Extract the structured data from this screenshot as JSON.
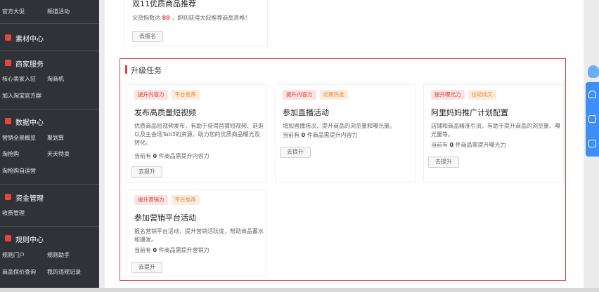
{
  "sidebar": {
    "row1": [
      "官方大促",
      "频道活动"
    ],
    "section_material": "素材中心",
    "section_merchant": "商家服务",
    "merchant_links": [
      [
        "核心卖家入驻",
        "淘商机"
      ],
      [
        "加入淘宝官方群",
        ""
      ]
    ],
    "section_data": "数据中心",
    "data_links": [
      [
        "营销全景概览",
        "聚划算"
      ],
      [
        "淘抢购",
        "天天特卖"
      ],
      [
        "淘抢购自运营",
        ""
      ]
    ],
    "section_fund": "资金管理",
    "fund_links": [
      [
        "收费管理",
        ""
      ]
    ],
    "section_rules": "规则中心",
    "rules_links": [
      [
        "规则门户",
        "规则助手"
      ],
      [
        "商品保价查询",
        "我的违规记录"
      ]
    ]
  },
  "top_card": {
    "title": "双11优质商品推荐",
    "desc_prefix": "尖货指数达",
    "desc_num": "80",
    "desc_suffix": "，即则获得大促推荐商品资格！",
    "button": "去报名"
  },
  "upgrade": {
    "title": "升级任务",
    "cards": [
      {
        "tags": [
          "提升内容力",
          "平台推荐"
        ],
        "title": "发布高质量短视频",
        "desc": "优质商品短视频发布，有助于获得首猜短视频、逛逛以及主会场Tab3的资源，助力您的优质商品曝光及转化。",
        "count_prefix": "当前有",
        "count_num": "0",
        "count_suffix": "件商品需提升内容力",
        "button": "去提升"
      },
      {
        "tags": [
          "提升内容力",
          "近期热推"
        ],
        "title": "参加直播活动",
        "desc": "增加直播场次，提升商品的浏览量和曝光量。",
        "count_prefix": "当前有",
        "count_num": "0",
        "count_suffix": "件商品需提升内容力",
        "button": "去提升"
      },
      {
        "tags": [
          "提升曝光力",
          "拉动成交"
        ],
        "title": "阿里妈妈推广计划配置",
        "desc": "店铺和商品精准引流，有助于提升商品的浏览量、曝光量等。",
        "count_prefix": "当前有",
        "count_num": "0",
        "count_suffix": "件商品需提升曝光力",
        "button": "去提升"
      },
      {
        "tags": [
          "提升营销力",
          "平台推荐"
        ],
        "title": "参加营销平台活动",
        "desc": "报名营销平台活动，提升营销活跃度，帮助商品蓄水和爆发。",
        "count_prefix": "当前有",
        "count_num": "0",
        "count_suffix": "件商品需提升营销力",
        "button": "去提升"
      }
    ]
  },
  "colors": {
    "accent_red": "#d64545",
    "sidebar_bg": "#2f3338",
    "float_blue": "#3e8ef7"
  },
  "icons": [
    "material-icon",
    "merchant-icon",
    "data-icon",
    "fund-icon",
    "rules-icon",
    "service-icon",
    "shield-icon",
    "home-icon"
  ]
}
